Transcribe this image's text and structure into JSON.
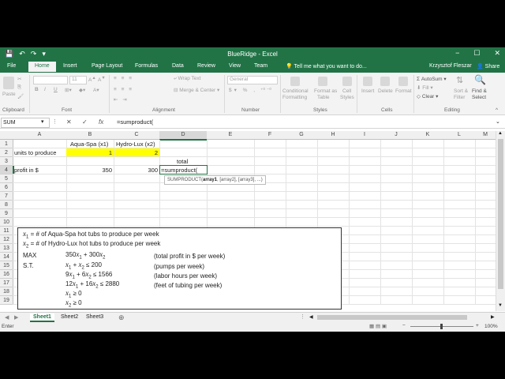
{
  "window": {
    "title": "BlueRidge - Excel",
    "minimize": "−",
    "restore": "☐",
    "close": "✕"
  },
  "qat": {
    "save": "💾",
    "undo": "↶",
    "redo": "↷",
    "customize": "▾"
  },
  "tabs": [
    "File",
    "Home",
    "Insert",
    "Page Layout",
    "Formulas",
    "Data",
    "Review",
    "View",
    "Team"
  ],
  "active_tab": "Home",
  "tell_me": "Tell me what you want to do...",
  "user": "Krzysztof Fleszar",
  "share": "Share",
  "ribbon": {
    "paste": "Paste",
    "clipboard": "Clipboard",
    "font_size": "11",
    "font": "Font",
    "wrap_text": "Wrap Text",
    "merge_center": "Merge & Center",
    "alignment": "Alignment",
    "number_format": "General",
    "number": "Number",
    "conditional_formatting_1": "Conditional",
    "conditional_formatting_2": "Formatting",
    "format_as_table_1": "Format as",
    "format_as_table_2": "Table",
    "cell_styles_1": "Cell",
    "cell_styles_2": "Styles",
    "styles": "Styles",
    "insert": "Insert",
    "delete": "Delete",
    "format": "Format",
    "cells": "Cells",
    "autosum": "AutoSum",
    "fill": "Fill",
    "clear": "Clear",
    "sort_filter_1": "Sort &",
    "sort_filter_2": "Filter",
    "find_select_1": "Find &",
    "find_select_2": "Select",
    "editing": "Editing",
    "bold": "B",
    "italic": "I",
    "underline": "U"
  },
  "formula_bar": {
    "name_box": "SUM",
    "cancel": "✕",
    "enter": "✓",
    "fx": "fx",
    "formula": "=sumproduct("
  },
  "columns": [
    "A",
    "B",
    "C",
    "D",
    "E",
    "F",
    "G",
    "H",
    "I",
    "J",
    "K",
    "L",
    "M"
  ],
  "rows": [
    "1",
    "2",
    "3",
    "4",
    "5",
    "6",
    "7",
    "8",
    "9",
    "10",
    "11",
    "12",
    "13",
    "14",
    "15",
    "16",
    "17",
    "18",
    "19"
  ],
  "cells": {
    "B1": "Aqua-Spa (x1)",
    "C1": "Hydro-Lux (x2)",
    "A2": "units to produce",
    "B2": "1",
    "C2": "2",
    "D3": "total",
    "A4": "profit in $",
    "B4": "350",
    "C4": "300",
    "D4": "=sumproduct("
  },
  "tooltip": {
    "name": "SUMPRODUCT(",
    "arg1": "array1",
    "rest": ", [array2], [array3], ...)"
  },
  "textbox": {
    "x1_def": "= # of Aqua-Spa hot tubs to produce per week",
    "x2_def": "= # of Hydro-Lux hot tubs to produce per week",
    "max": "MAX",
    "st": "S.T.",
    "obj": "350x1 + 300x2",
    "c1": "x1 + x2 ≤ 200",
    "c2": "9x1 + 6x2 ≤ 1566",
    "c3": "12x1 + 16x2 ≤ 2880",
    "c4": "x1 ≥ 0",
    "c5": "x2 ≥ 0",
    "n_obj": "(total profit in $ per week)",
    "n_c1": "(pumps per week)",
    "n_c2": "(labor hours per week)",
    "n_c3": "(feet of tubing per week)"
  },
  "sheets": [
    "Sheet1",
    "Sheet2",
    "Sheet3"
  ],
  "active_sheet": "Sheet1",
  "add_sheet": "⊕",
  "status": {
    "mode": "Enter",
    "zoom": "100%"
  }
}
